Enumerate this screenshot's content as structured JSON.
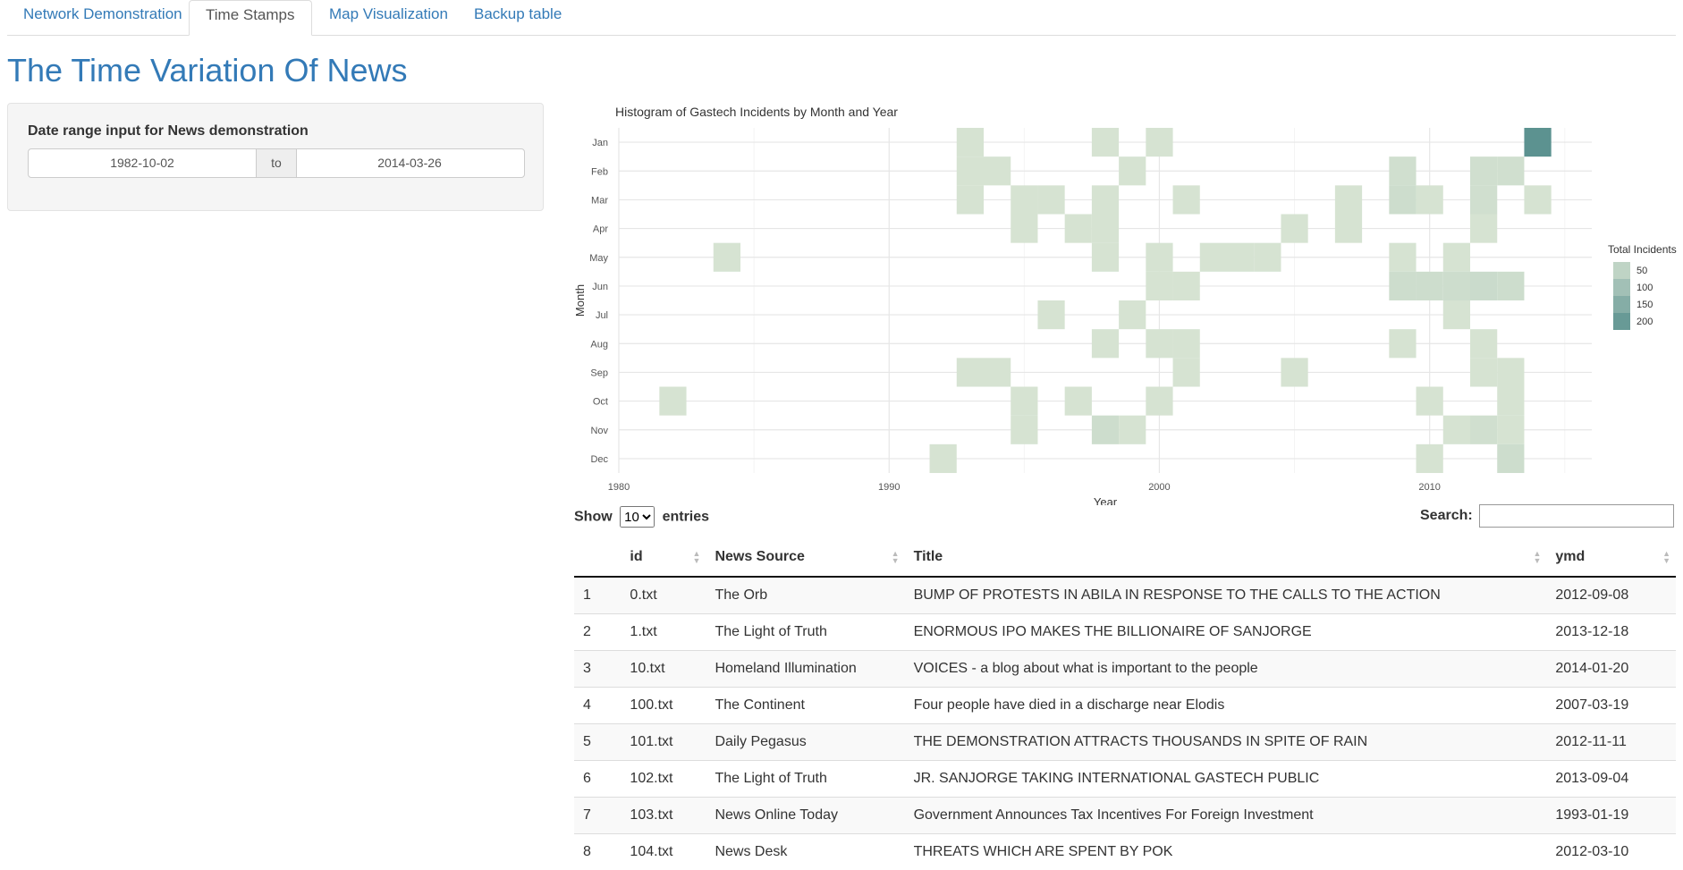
{
  "tabs": [
    {
      "label": "Network Demonstration",
      "active": false
    },
    {
      "label": "Time Stamps",
      "active": true
    },
    {
      "label": "Map Visualization",
      "active": false
    },
    {
      "label": "Backup table",
      "active": false
    }
  ],
  "page_title": "The Time Variation Of News",
  "sidebar": {
    "label": "Date range input for News demonstration",
    "start": "1982-10-02",
    "sep": "to",
    "end": "2014-03-26"
  },
  "chart_data": {
    "type": "heatmap",
    "title": "Histogram of Gastech Incidents by Month and Year",
    "xlabel": "Year",
    "ylabel": "Month",
    "xlim": [
      1980,
      2016
    ],
    "x_ticks": [
      1980,
      1990,
      2000,
      2010
    ],
    "months": [
      "Jan",
      "Feb",
      "Mar",
      "Apr",
      "May",
      "Jun",
      "Jul",
      "Aug",
      "Sep",
      "Oct",
      "Nov",
      "Dec"
    ],
    "legend_title": "Total Incidents",
    "legend_values": [
      50,
      100,
      150,
      200
    ],
    "color_low": "#d6e3d2",
    "color_high": "#5c9290",
    "cells": [
      {
        "year": 1982,
        "month": "Oct",
        "value": 10
      },
      {
        "year": 1984,
        "month": "May",
        "value": 10
      },
      {
        "year": 1992,
        "month": "Dec",
        "value": 10
      },
      {
        "year": 1993,
        "month": "Jan",
        "value": 10
      },
      {
        "year": 1993,
        "month": "Feb",
        "value": 10
      },
      {
        "year": 1993,
        "month": "Mar",
        "value": 10
      },
      {
        "year": 1993,
        "month": "Sep",
        "value": 10
      },
      {
        "year": 1994,
        "month": "Feb",
        "value": 10
      },
      {
        "year": 1994,
        "month": "Sep",
        "value": 10
      },
      {
        "year": 1995,
        "month": "Mar",
        "value": 10
      },
      {
        "year": 1995,
        "month": "Apr",
        "value": 10
      },
      {
        "year": 1995,
        "month": "Oct",
        "value": 10
      },
      {
        "year": 1995,
        "month": "Nov",
        "value": 10
      },
      {
        "year": 1996,
        "month": "Mar",
        "value": 10
      },
      {
        "year": 1996,
        "month": "Jul",
        "value": 10
      },
      {
        "year": 1997,
        "month": "Apr",
        "value": 10
      },
      {
        "year": 1997,
        "month": "Oct",
        "value": 10
      },
      {
        "year": 1998,
        "month": "Jan",
        "value": 10
      },
      {
        "year": 1998,
        "month": "Mar",
        "value": 10
      },
      {
        "year": 1998,
        "month": "Apr",
        "value": 10
      },
      {
        "year": 1998,
        "month": "May",
        "value": 10
      },
      {
        "year": 1998,
        "month": "Aug",
        "value": 10
      },
      {
        "year": 1998,
        "month": "Nov",
        "value": 25
      },
      {
        "year": 1999,
        "month": "Feb",
        "value": 10
      },
      {
        "year": 1999,
        "month": "Jul",
        "value": 10
      },
      {
        "year": 1999,
        "month": "Nov",
        "value": 10
      },
      {
        "year": 2000,
        "month": "Jan",
        "value": 10
      },
      {
        "year": 2000,
        "month": "May",
        "value": 10
      },
      {
        "year": 2000,
        "month": "Jun",
        "value": 10
      },
      {
        "year": 2000,
        "month": "Aug",
        "value": 10
      },
      {
        "year": 2000,
        "month": "Oct",
        "value": 10
      },
      {
        "year": 2001,
        "month": "Mar",
        "value": 10
      },
      {
        "year": 2001,
        "month": "Jun",
        "value": 10
      },
      {
        "year": 2001,
        "month": "Aug",
        "value": 10
      },
      {
        "year": 2001,
        "month": "Sep",
        "value": 10
      },
      {
        "year": 2002,
        "month": "May",
        "value": 10
      },
      {
        "year": 2003,
        "month": "May",
        "value": 10
      },
      {
        "year": 2004,
        "month": "May",
        "value": 10
      },
      {
        "year": 2005,
        "month": "Apr",
        "value": 10
      },
      {
        "year": 2005,
        "month": "Sep",
        "value": 10
      },
      {
        "year": 2007,
        "month": "Mar",
        "value": 10
      },
      {
        "year": 2007,
        "month": "Apr",
        "value": 10
      },
      {
        "year": 2009,
        "month": "Feb",
        "value": 20
      },
      {
        "year": 2009,
        "month": "Mar",
        "value": 25
      },
      {
        "year": 2009,
        "month": "May",
        "value": 10
      },
      {
        "year": 2009,
        "month": "Jun",
        "value": 25
      },
      {
        "year": 2009,
        "month": "Aug",
        "value": 10
      },
      {
        "year": 2010,
        "month": "Mar",
        "value": 10
      },
      {
        "year": 2010,
        "month": "Jun",
        "value": 25
      },
      {
        "year": 2010,
        "month": "Oct",
        "value": 10
      },
      {
        "year": 2010,
        "month": "Dec",
        "value": 10
      },
      {
        "year": 2011,
        "month": "May",
        "value": 10
      },
      {
        "year": 2011,
        "month": "Jun",
        "value": 25
      },
      {
        "year": 2011,
        "month": "Jul",
        "value": 10
      },
      {
        "year": 2011,
        "month": "Nov",
        "value": 10
      },
      {
        "year": 2012,
        "month": "Feb",
        "value": 20
      },
      {
        "year": 2012,
        "month": "Mar",
        "value": 20
      },
      {
        "year": 2012,
        "month": "Apr",
        "value": 10
      },
      {
        "year": 2012,
        "month": "Jun",
        "value": 30
      },
      {
        "year": 2012,
        "month": "Aug",
        "value": 10
      },
      {
        "year": 2012,
        "month": "Sep",
        "value": 10
      },
      {
        "year": 2012,
        "month": "Nov",
        "value": 20
      },
      {
        "year": 2013,
        "month": "Feb",
        "value": 20
      },
      {
        "year": 2013,
        "month": "Jun",
        "value": 25
      },
      {
        "year": 2013,
        "month": "Sep",
        "value": 10
      },
      {
        "year": 2013,
        "month": "Oct",
        "value": 10
      },
      {
        "year": 2013,
        "month": "Nov",
        "value": 10
      },
      {
        "year": 2013,
        "month": "Dec",
        "value": 25
      },
      {
        "year": 2014,
        "month": "Jan",
        "value": 220
      },
      {
        "year": 2014,
        "month": "Mar",
        "value": 10
      }
    ]
  },
  "table": {
    "show_label": "Show",
    "entries_label": "entries",
    "page_length": "10",
    "search_label": "Search:",
    "columns": [
      "",
      "id",
      "News Source",
      "Title",
      "ymd"
    ],
    "rows": [
      [
        "1",
        "0.txt",
        "The Orb",
        "BUMP OF PROTESTS IN ABILA IN RESPONSE TO THE CALLS TO THE ACTION",
        "2012-09-08"
      ],
      [
        "2",
        "1.txt",
        "The Light of Truth",
        "ENORMOUS IPO MAKES THE BILLIONAIRE OF SANJORGE",
        "2013-12-18"
      ],
      [
        "3",
        "10.txt",
        "Homeland Illumination",
        "VOICES - a blog about what is important to the people",
        "2014-01-20"
      ],
      [
        "4",
        "100.txt",
        "The Continent",
        "Four people have died in a discharge near Elodis",
        "2007-03-19"
      ],
      [
        "5",
        "101.txt",
        "Daily Pegasus",
        "THE DEMONSTRATION ATTRACTS THOUSANDS IN SPITE OF RAIN",
        "2012-11-11"
      ],
      [
        "6",
        "102.txt",
        "The Light of Truth",
        "JR. SANJORGE TAKING INTERNATIONAL GASTECH PUBLIC",
        "2013-09-04"
      ],
      [
        "7",
        "103.txt",
        "News Online Today",
        "Government Announces Tax Incentives For Foreign Investment",
        "1993-01-19"
      ],
      [
        "8",
        "104.txt",
        "News Desk",
        "THREATS WHICH ARE SPENT BY POK",
        "2012-03-10"
      ]
    ]
  }
}
